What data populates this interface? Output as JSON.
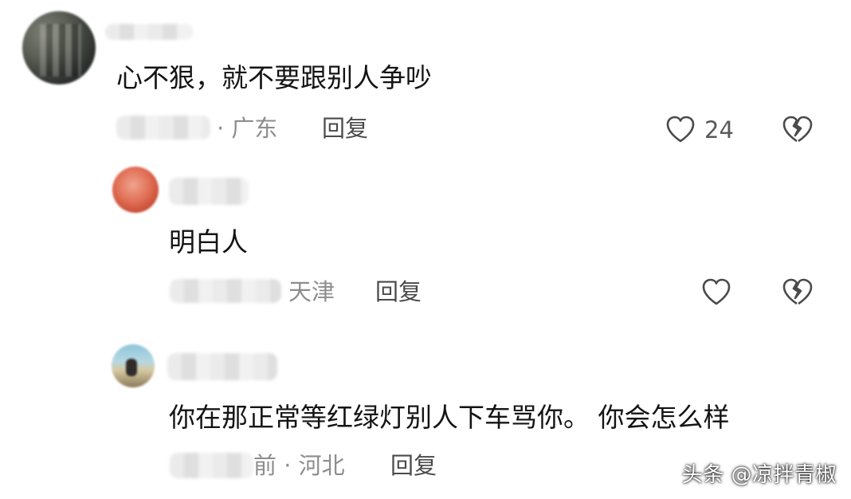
{
  "comments": [
    {
      "text": "心不狠，就不要跟别人争吵",
      "location": "· 广东",
      "reply_label": "回复",
      "like_count": "24"
    },
    {
      "text": "明白人",
      "location": "天津",
      "reply_label": "回复"
    },
    {
      "text": "你在那正常等红绿灯别人下车骂你。 你会怎么样",
      "location": "前 · 河北",
      "reply_label": "回复"
    }
  ],
  "watermark": "头条 @凉拌青椒",
  "icons": {
    "like": "heart-outline-icon",
    "dislike": "broken-heart-icon"
  },
  "colors": {
    "text": "#141414",
    "meta": "#8d8d8d",
    "icon": "#4a4a4a"
  }
}
